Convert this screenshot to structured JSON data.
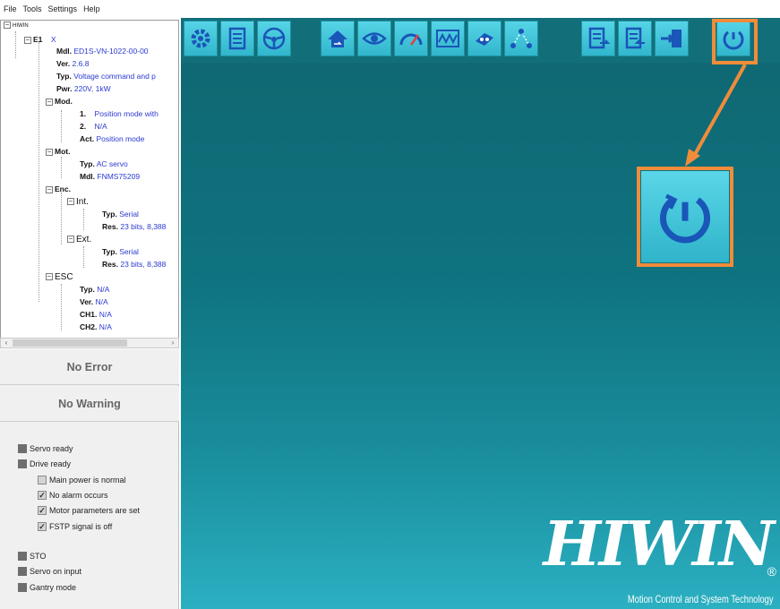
{
  "menu": [
    "File",
    "Tools",
    "Settings",
    "Help"
  ],
  "tree": {
    "root": "HIWIN",
    "axis": "E1",
    "axis_value": "X",
    "mdl_key": "Mdl.",
    "mdl_val": "ED1S-VN-1022-00-00",
    "ver_key": "Ver.",
    "ver_val": "2.6.8",
    "typ_key": "Typ.",
    "typ_val": "Voltage command and p",
    "pwr_key": "Pwr.",
    "pwr_val": "220V, 1kW",
    "mod": "Mod.",
    "mod_1_key": "1.",
    "mod_1_val": "Position mode with",
    "mod_2_key": "2.",
    "mod_2_val": "N/A",
    "mod_act_key": "Act.",
    "mod_act_val": "Position mode",
    "mot": "Mot.",
    "mot_typ_key": "Typ.",
    "mot_typ_val": "AC servo",
    "mot_mdl_key": "Mdl.",
    "mot_mdl_val": "FNMS75209",
    "enc": "Enc.",
    "int": "Int.",
    "int_typ_key": "Typ.",
    "int_typ_val": "Serial",
    "int_res_key": "Res.",
    "int_res_val": "23 bits, 8,388",
    "ext": "Ext.",
    "ext_typ_key": "Typ.",
    "ext_typ_val": "Serial",
    "ext_res_key": "Res.",
    "ext_res_val": "23 bits, 8,388",
    "esc": "ESC",
    "esc_typ_key": "Typ.",
    "esc_typ_val": "N/A",
    "esc_ver_key": "Ver.",
    "esc_ver_val": "N/A",
    "esc_ch1_key": "CH1.",
    "esc_ch1_val": "N/A",
    "esc_ch2_key": "CH2.",
    "esc_ch2_val": "N/A"
  },
  "status": {
    "error": "No Error",
    "warning": "No Warning",
    "servo_ready": "Servo ready",
    "drive_ready": "Drive ready",
    "main_power": "Main power is normal",
    "no_alarm": "No alarm occurs",
    "motor_params": "Motor parameters are set",
    "fstp": "FSTP signal is off",
    "sto": "STO",
    "servo_on_input": "Servo on input",
    "gantry": "Gantry mode"
  },
  "toolbar_icons": [
    "wrench-gear-icon",
    "document-list-icon",
    "steering-wheel-icon",
    "home-arrow-icon",
    "eye-icon",
    "speedometer-icon",
    "scope-wave-icon",
    "tuning-icon",
    "path-nodes-icon",
    "export-doc-icon",
    "import-doc-icon",
    "transfer-icon",
    "power-reset-icon"
  ],
  "brand": {
    "logo": "HIWIN",
    "registered": "®",
    "tagline": "Motion Control and System Technology"
  },
  "colors": {
    "accent_orange": "#f08c3a",
    "teal_bg": "#0f6e79",
    "button_cyan": "#3cc3d8",
    "icon_blue": "#1a55b8",
    "tree_value_blue": "#2a3ad0"
  }
}
